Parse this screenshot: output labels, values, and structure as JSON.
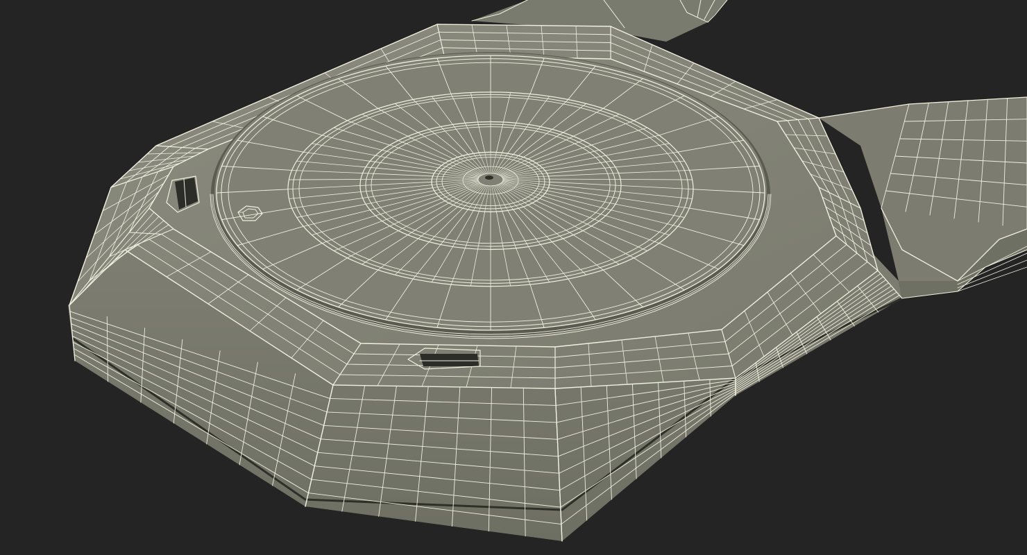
{
  "scene": {
    "subject": "wireframe-3d-model",
    "colors": {
      "background": "#242424",
      "surface": "#7e7f72",
      "surface_light": "#8a8b7e",
      "surface_dark": "#6b6c60",
      "wire": "#f1f1e0",
      "groove": "#2e2f29"
    }
  }
}
